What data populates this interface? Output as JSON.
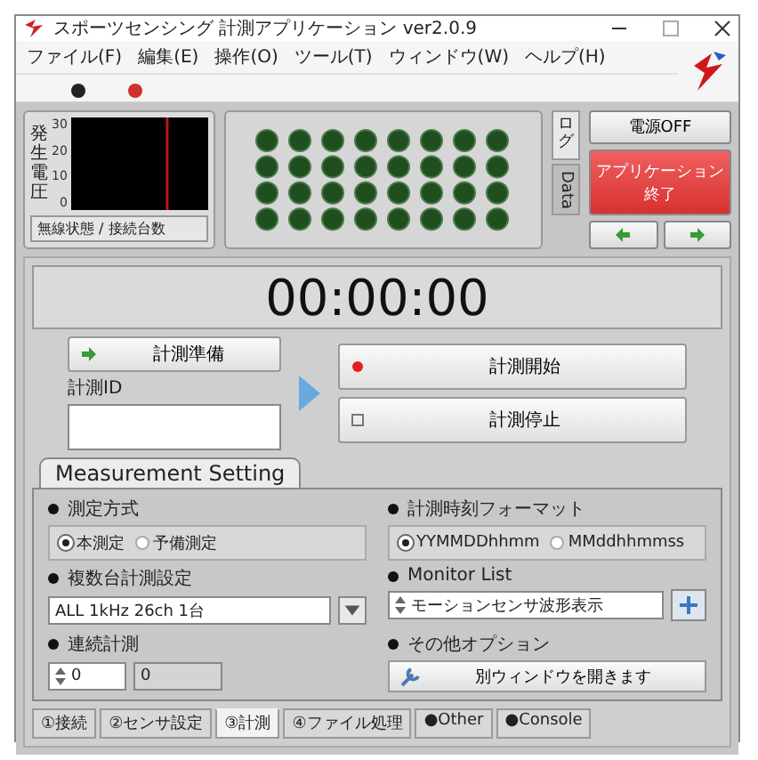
{
  "window": {
    "title": "スポーツセンシング 計測アプリケーション ver2.0.9"
  },
  "menu": [
    "ファイル(F)",
    "編集(E)",
    "操作(O)",
    "ツール(T)",
    "ウィンドウ(W)",
    "ヘルプ(H)"
  ],
  "meter": {
    "axis_label": "発生電圧",
    "ticks": [
      "30",
      "20",
      "10",
      "0"
    ]
  },
  "status_field": "無線状態 / 接続台数",
  "side_tabs": [
    {
      "label": "ログ",
      "selected": true
    },
    {
      "label": "Data",
      "selected": false
    }
  ],
  "power_button": "電源OFF",
  "exit_button": "アプリケーション終了",
  "timer": "00:00:00",
  "prepare_button": "計測準備",
  "id_label": "計測ID",
  "start_button": "計測開始",
  "stop_button": "計測停止",
  "settings": {
    "title": "Measurement Setting",
    "mode": {
      "label": "測定方式",
      "options": [
        {
          "label": "本測定",
          "selected": true
        },
        {
          "label": "予備測定",
          "selected": false
        }
      ]
    },
    "time_format": {
      "label": "計測時刻フォーマット",
      "options": [
        {
          "label": "YYMMDDhhmm",
          "selected": true
        },
        {
          "label": "MMddhhmmss",
          "selected": false
        }
      ]
    },
    "multi": {
      "label": "複数台計測設定",
      "value": "ALL 1kHz 26ch 1台"
    },
    "monitor": {
      "label": "Monitor List",
      "value": "モーションセンサ波形表示"
    },
    "continuous": {
      "label": "連続計測",
      "count": "0",
      "second": "0"
    },
    "options": {
      "label": "その他オプション",
      "button": "別ウィンドウを開きます"
    }
  },
  "bottom_tabs": [
    {
      "label": "①接続",
      "selected": false
    },
    {
      "label": "②センサ設定",
      "selected": false
    },
    {
      "label": "③計測",
      "selected": true
    },
    {
      "label": "④ファイル処理",
      "selected": false
    },
    {
      "label": "●Other",
      "selected": false
    },
    {
      "label": "●Console",
      "selected": false
    }
  ]
}
